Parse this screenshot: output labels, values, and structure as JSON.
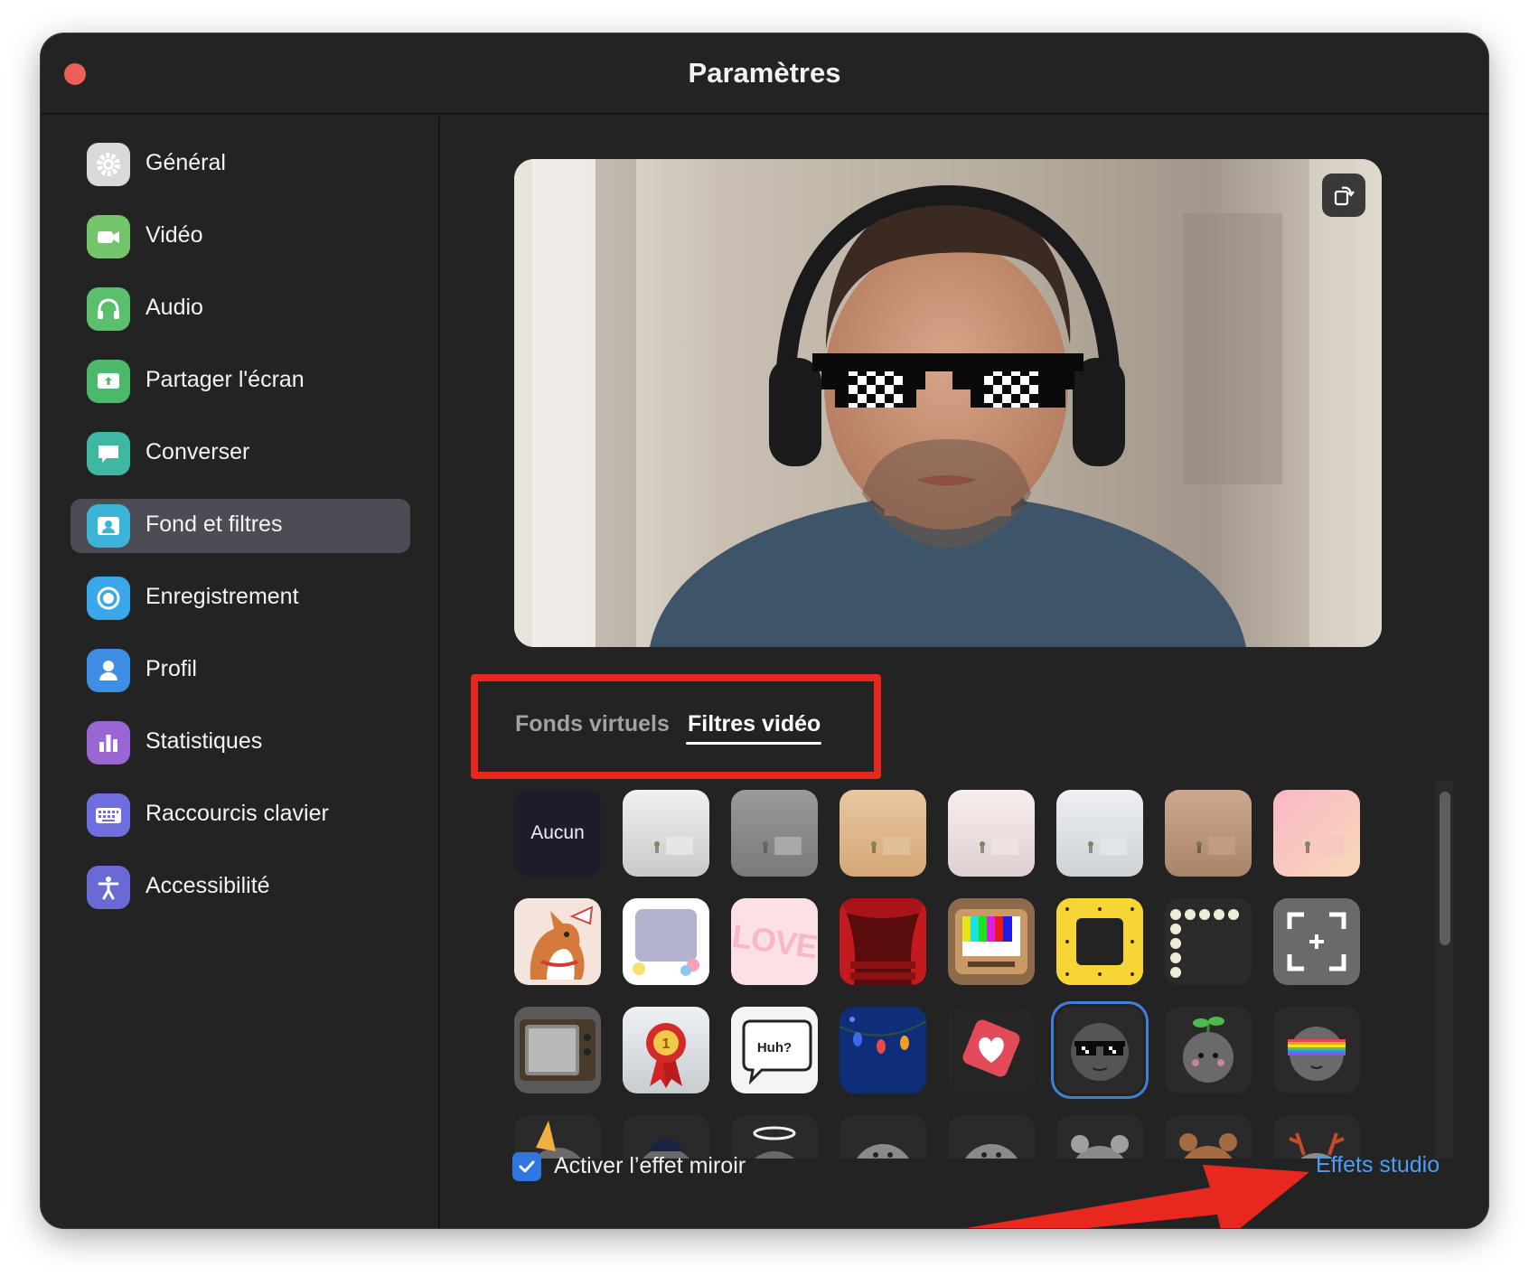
{
  "window": {
    "title": "Paramètres"
  },
  "sidebar": {
    "items": [
      {
        "label": "Général",
        "icon": "gear-icon",
        "color": "#d9d9d9",
        "active": false
      },
      {
        "label": "Vidéo",
        "icon": "video-camera-icon",
        "color": "#74c46b",
        "active": false
      },
      {
        "label": "Audio",
        "icon": "headphones-icon",
        "color": "#5bbf6e",
        "active": false
      },
      {
        "label": "Partager l'écran",
        "icon": "share-screen-icon",
        "color": "#4cb86a",
        "active": false
      },
      {
        "label": "Converser",
        "icon": "chat-bubble-icon",
        "color": "#3fb8a3",
        "active": false
      },
      {
        "label": "Fond et filtres",
        "icon": "background-person-icon",
        "color": "#3bb4d8",
        "active": true
      },
      {
        "label": "Enregistrement",
        "icon": "record-icon",
        "color": "#3aa8e8",
        "active": false
      },
      {
        "label": "Profil",
        "icon": "profile-icon",
        "color": "#3f8ee6",
        "active": false
      },
      {
        "label": "Statistiques",
        "icon": "bar-chart-icon",
        "color": "#9a66d4",
        "active": false
      },
      {
        "label": "Raccourcis clavier",
        "icon": "keyboard-icon",
        "color": "#6e6ee0",
        "active": false
      },
      {
        "label": "Accessibilité",
        "icon": "accessibility-icon",
        "color": "#6a6ad6",
        "active": false
      }
    ]
  },
  "preview": {
    "rotate_icon": "rotate-camera-icon"
  },
  "tabs": [
    {
      "label": "Fonds virtuels",
      "active": false
    },
    {
      "label": "Filtres vidéo",
      "active": true
    }
  ],
  "filters": {
    "none_label": "Aucun",
    "huh_label": "Huh?",
    "love_label": "LOVE",
    "selected_index": 21
  },
  "footer": {
    "mirror_label": "Activer l’effet miroir",
    "mirror_checked": true,
    "studio_label": "Effets studio"
  },
  "colors": {
    "accent": "#2e76e0",
    "link": "#4a9ff5",
    "annotation": "#e8281e"
  }
}
